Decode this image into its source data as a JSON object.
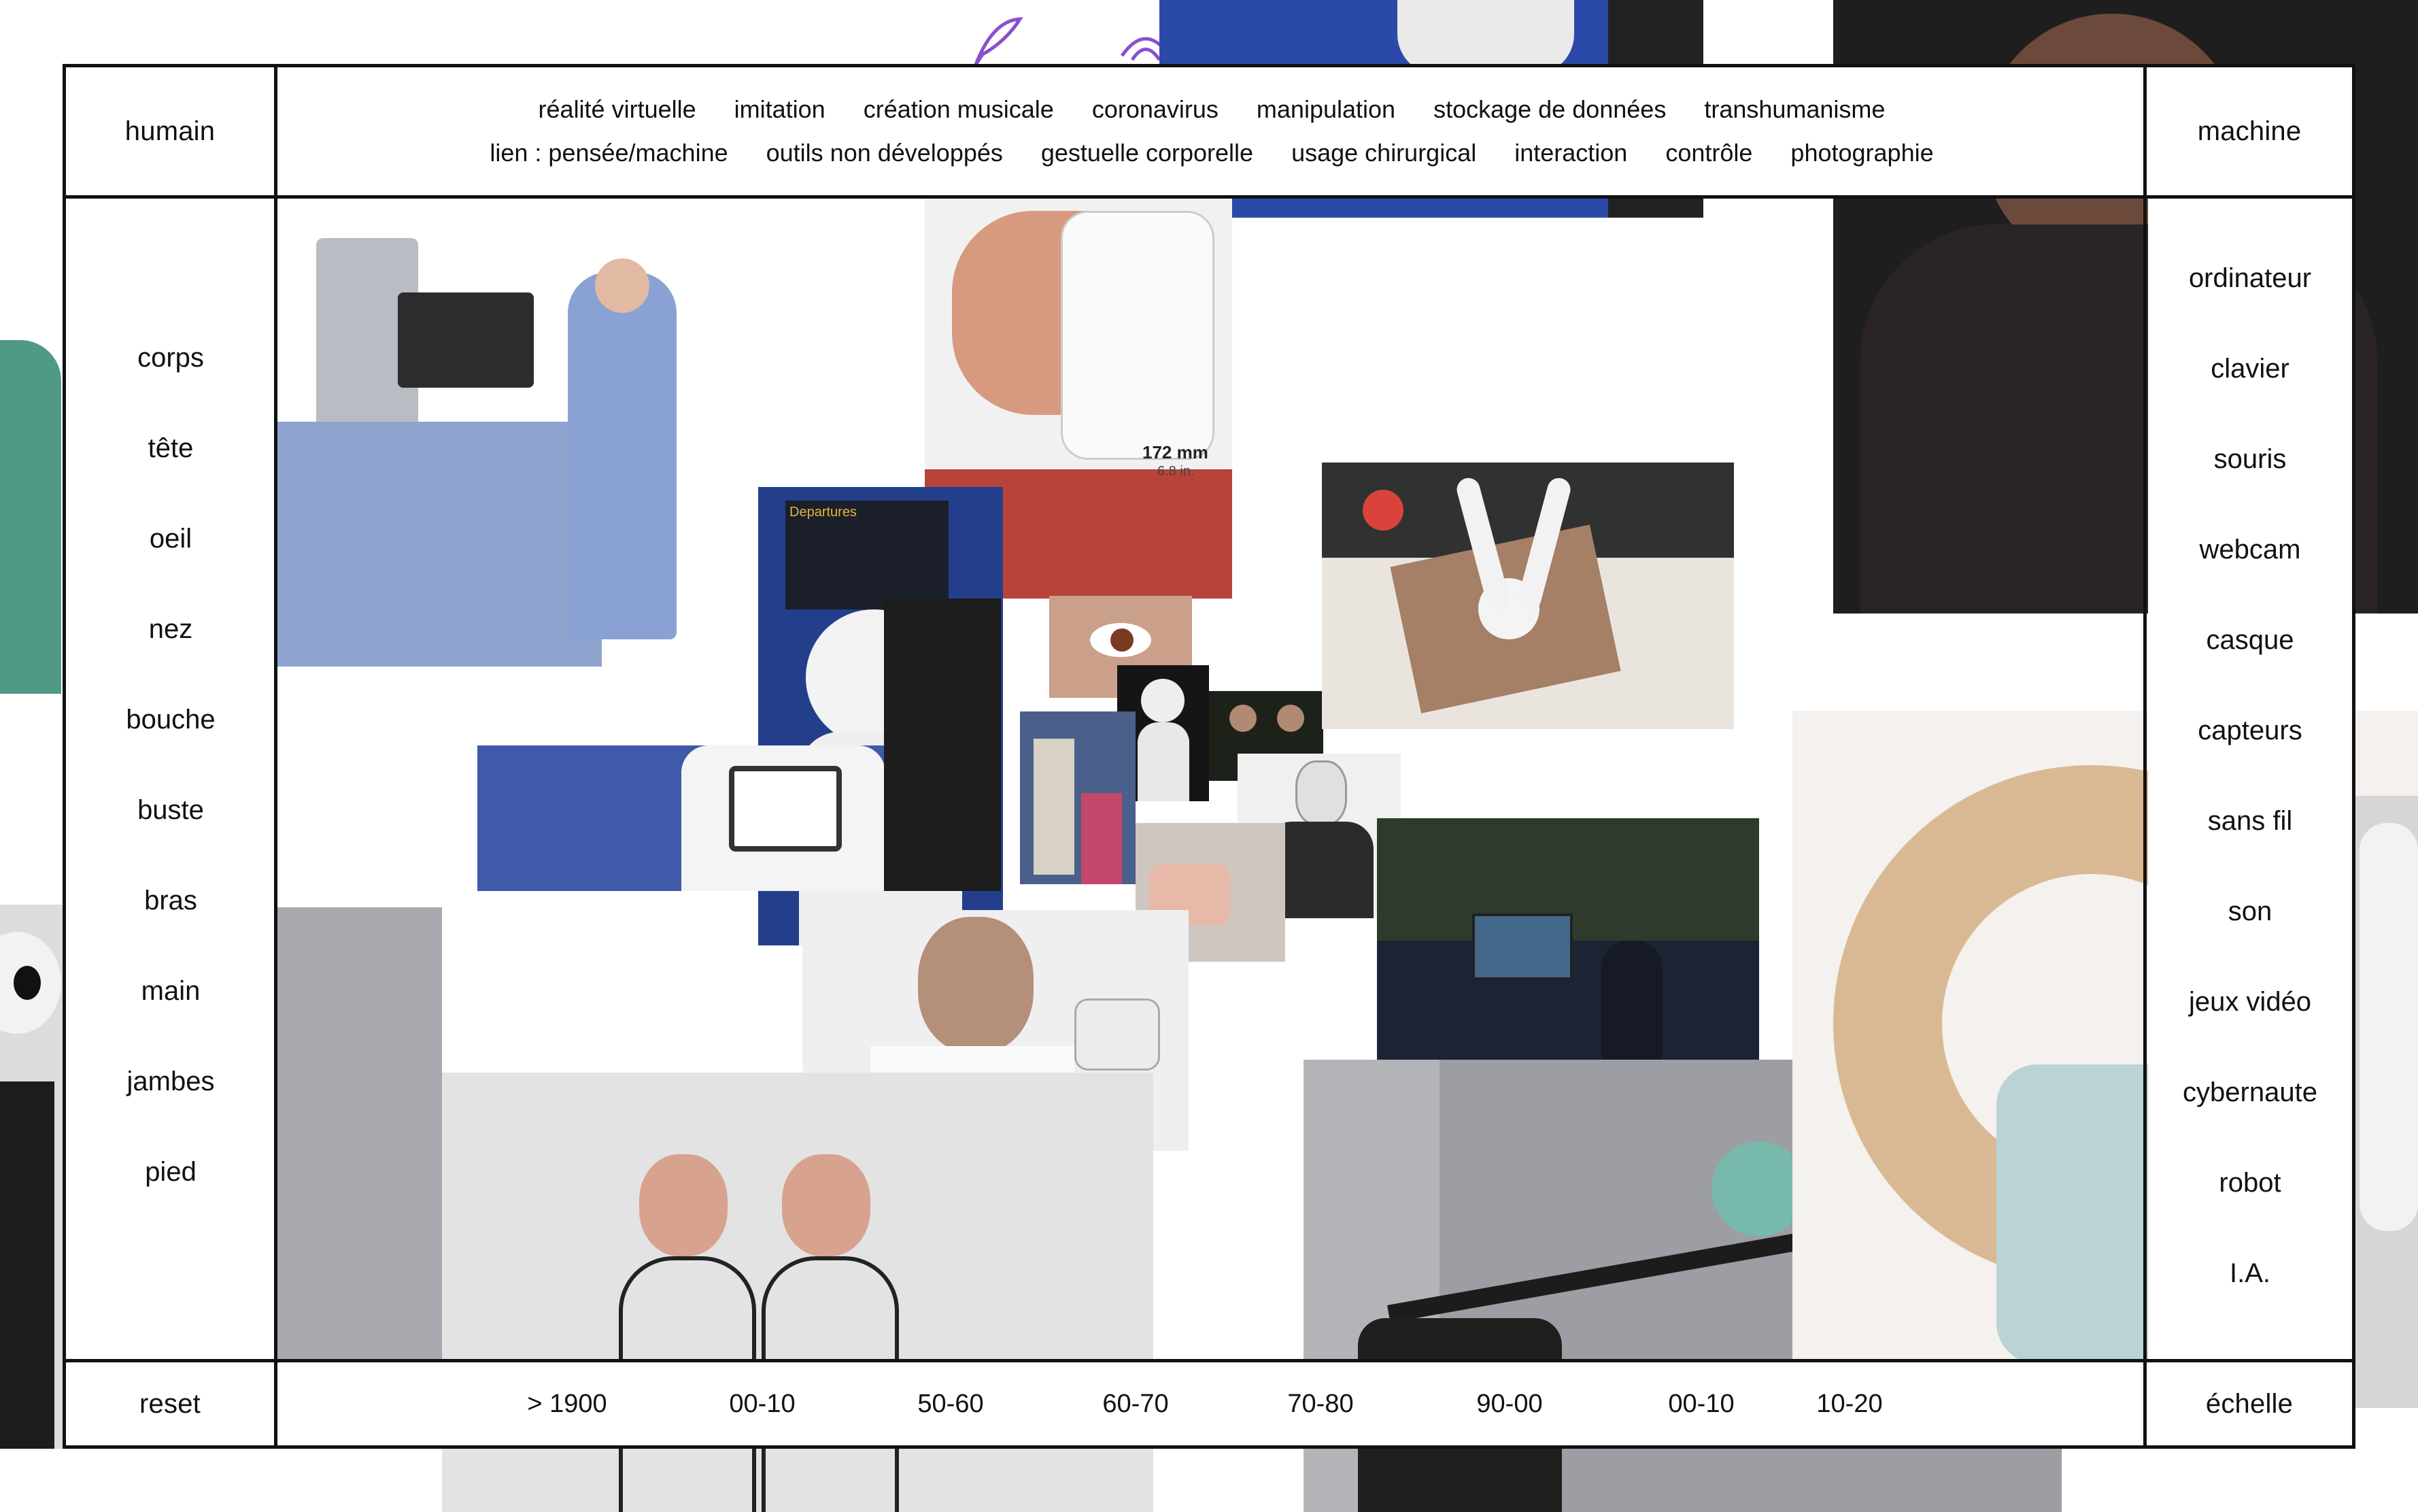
{
  "corners": {
    "top_left": "humain",
    "top_right": "machine",
    "bottom_left": "reset",
    "bottom_right": "échelle"
  },
  "top_tags": {
    "row1": [
      "réalité virtuelle",
      "imitation",
      "création musicale",
      "coronavirus",
      "manipulation",
      "stockage de données",
      "transhumanisme"
    ],
    "row2": [
      "lien : pensée/machine",
      "outils non développés",
      "gestuelle corporelle",
      "usage chirurgical",
      "interaction",
      "contrôle",
      "photographie"
    ]
  },
  "left_tags": [
    "corps",
    "tête",
    "oeil",
    "nez",
    "bouche",
    "buste",
    "bras",
    "main",
    "jambes",
    "pied"
  ],
  "right_tags": [
    "ordinateur",
    "clavier",
    "souris",
    "webcam",
    "casque",
    "capteurs",
    "sans fil",
    "son",
    "jeux vidéo",
    "cybernaute",
    "robot",
    "I.A."
  ],
  "timeline": [
    "> 1900",
    "00-10",
    "50-60",
    "60-70",
    "70-80",
    "90-00",
    "00-10",
    "10-20"
  ],
  "collage": {
    "vr_headset_caption": "172 mm",
    "vr_headset_subcaption": "6.8 in.",
    "departures_board": "Departures"
  },
  "colors": {
    "frame": "#111111",
    "background": "#ffffff",
    "accent_purple": "#8a4fd0",
    "surgical_blue": "#8fa3cf",
    "robot_white": "#f2f2f2",
    "wall_grey": "#9c9ea3"
  }
}
